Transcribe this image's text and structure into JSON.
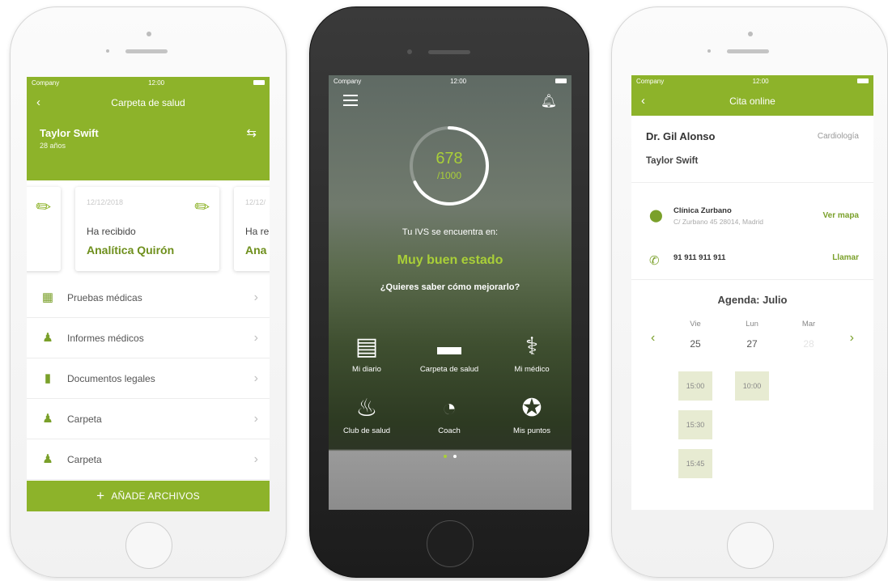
{
  "phone1": {
    "status": {
      "carrier": "Company",
      "time": "12:00"
    },
    "nav": {
      "title": "Carpeta de salud"
    },
    "profile": {
      "name": "Taylor Swift",
      "age": "28 años"
    },
    "cards": [
      {
        "date": "",
        "received": "",
        "title": ""
      },
      {
        "date": "12/12/2018",
        "received": "Ha recibido",
        "title": "Analítica Quirón"
      },
      {
        "date": "12/12/",
        "received": "Ha re",
        "title": "Ana"
      }
    ],
    "list": [
      {
        "label": "Pruebas médicas",
        "icon": "folder-icon"
      },
      {
        "label": "Informes médicos",
        "icon": "doctor-icon"
      },
      {
        "label": "Documentos legales",
        "icon": "document-icon"
      },
      {
        "label": "Carpeta",
        "icon": "doctor-icon"
      },
      {
        "label": "Carpeta",
        "icon": "doctor-icon"
      }
    ],
    "add_label": "AÑADE ARCHIVOS"
  },
  "phone2": {
    "status": {
      "carrier": "Company",
      "time": "12:00"
    },
    "score": {
      "value": "678",
      "total": "/1000",
      "fraction": 0.678
    },
    "ivs_text": "Tu IVS se encuentra en:",
    "state": "Muy buen estado",
    "improve": "¿Quieres saber cómo mejorarlo?",
    "tiles": [
      {
        "label": "Mi diario",
        "icon": "diary-icon",
        "glyph": "▤"
      },
      {
        "label": "Carpeta de salud",
        "icon": "folder-icon",
        "glyph": "▬"
      },
      {
        "label": "Mi médico",
        "icon": "stethoscope-icon",
        "glyph": "⚕"
      },
      {
        "label": "Club de salud",
        "icon": "massage-icon",
        "glyph": "♨"
      },
      {
        "label": "Coach",
        "icon": "coach-folder-icon",
        "glyph": "◔"
      },
      {
        "label": "Mis puntos",
        "icon": "award-icon",
        "glyph": "✪"
      }
    ],
    "page_dots": {
      "count": 2,
      "active": 0
    }
  },
  "phone3": {
    "status": {
      "carrier": "Company",
      "time": "12:00"
    },
    "nav": {
      "title": "Cita online"
    },
    "doctor": "Dr. Gil Alonso",
    "specialty": "Cardiología",
    "patient": "Taylor Swift",
    "clinic": {
      "name": "Clínica Zurbano",
      "address": "C/ Zurbano 45 28014, Madrid",
      "action": "Ver mapa"
    },
    "phone": {
      "number": "91 911 911 911",
      "action": "Llamar"
    },
    "agenda_title": "Agenda: Julio",
    "days": [
      {
        "name": "Vie",
        "date": "25",
        "slots": [
          "15:00",
          "15:30",
          "15:45"
        ]
      },
      {
        "name": "Lun",
        "date": "27",
        "slots": [
          "10:00"
        ]
      },
      {
        "name": "Mar",
        "date": "28",
        "slots": []
      }
    ]
  },
  "colors": {
    "accent": "#8db32a",
    "accent_light": "#a9cf38"
  }
}
